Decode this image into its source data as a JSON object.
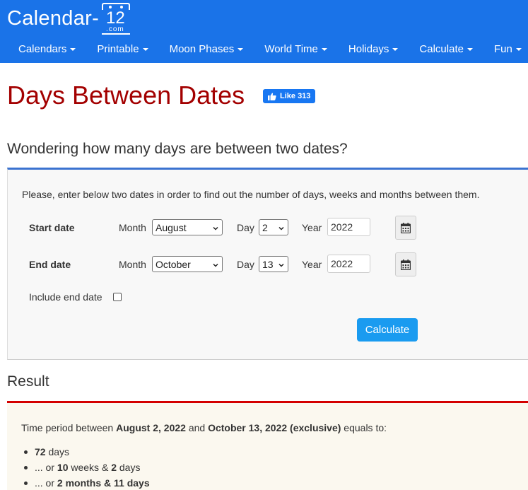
{
  "header": {
    "logo_text": "Calendar-",
    "logo_number": "12",
    "logo_domain": ".com",
    "nav": [
      {
        "label": "Calendars"
      },
      {
        "label": "Printable"
      },
      {
        "label": "Moon Phases"
      },
      {
        "label": "World Time"
      },
      {
        "label": "Holidays"
      },
      {
        "label": "Calculate"
      },
      {
        "label": "Fun"
      }
    ]
  },
  "page": {
    "title": "Days Between Dates",
    "fb_like": "Like 313",
    "subtitle": "Wondering how many days are between two dates?"
  },
  "form": {
    "intro": "Please, enter below two dates in order to find out the number of days, weeks and months between them.",
    "month_label": "Month",
    "day_label": "Day",
    "year_label": "Year",
    "start": {
      "label": "Start date",
      "month": "August",
      "day": "2",
      "year": "2022"
    },
    "end": {
      "label": "End date",
      "month": "October",
      "day": "13",
      "year": "2022"
    },
    "include_end_label": "Include end date",
    "include_end_checked": false,
    "calculate_label": "Calculate"
  },
  "result": {
    "title": "Result",
    "line_prefix": "Time period between",
    "start_date": "August 2, 2022",
    "and": "and",
    "end_date": "October 13, 2022 (exclusive)",
    "line_suffix": "equals to:",
    "days": "72",
    "days_unit": "days",
    "weeks_prefix": "... or",
    "weeks": "10",
    "weeks_unit": "weeks &",
    "weeks_days": "2",
    "weeks_days_unit": "days",
    "months_prefix": "... or",
    "months": "2 months & 11 days"
  },
  "colors": {
    "header_bg": "#1a73e8",
    "title": "#a30000",
    "form_accent": "#3b73d0",
    "result_accent": "#d40000",
    "button": "#1a9bf0"
  }
}
